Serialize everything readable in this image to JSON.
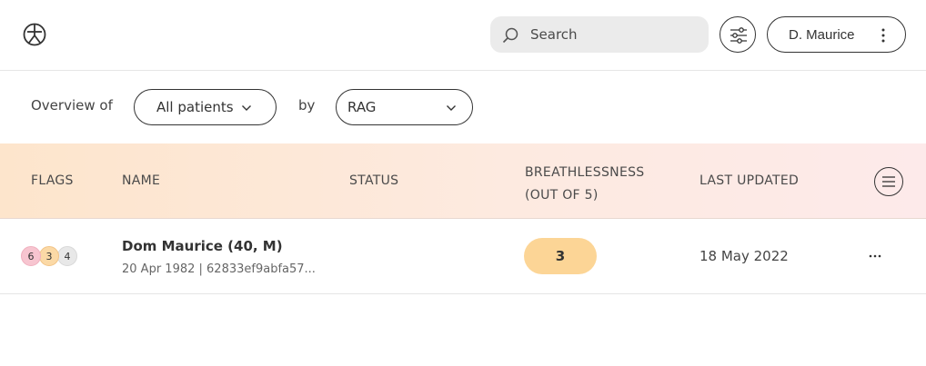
{
  "header": {
    "logo_icon": "figure-in-circle-icon",
    "search": {
      "placeholder": "Search",
      "value": ""
    },
    "filter_icon": "sliders-icon",
    "user": {
      "name": "D. Maurice",
      "menu_icon": "kebab-vertical-icon"
    }
  },
  "overview": {
    "label": "Overview of",
    "patients_select": "All patients",
    "by_label": "by",
    "group_select": "RAG"
  },
  "table": {
    "columns": {
      "flags": "FLAGS",
      "name": "NAME",
      "status": "STATUS",
      "breathlessness_line1": "BREATHLESSNESS",
      "breathlessness_line2": "(OUT OF 5)",
      "last_updated": "LAST UPDATED"
    },
    "column_menu_icon": "hamburger-circle-icon",
    "rows": [
      {
        "flags": {
          "red": "6",
          "amber": "3",
          "grey": "4"
        },
        "name": "Dom Maurice (40, M)",
        "meta": "20 Apr 1982 | 62833ef9abfa57...",
        "status": "",
        "breathlessness": "3",
        "last_updated": "18 May 2022",
        "more_icon": "ellipsis-horizontal-icon"
      }
    ]
  },
  "colors": {
    "header_gradient_start": "#fde5cc",
    "header_gradient_end": "#fdeaea",
    "score_amber": "#fcd596",
    "flag_red": "#f7c5d0",
    "flag_amber": "#fbd9a6",
    "flag_grey": "#e8e8e8"
  }
}
